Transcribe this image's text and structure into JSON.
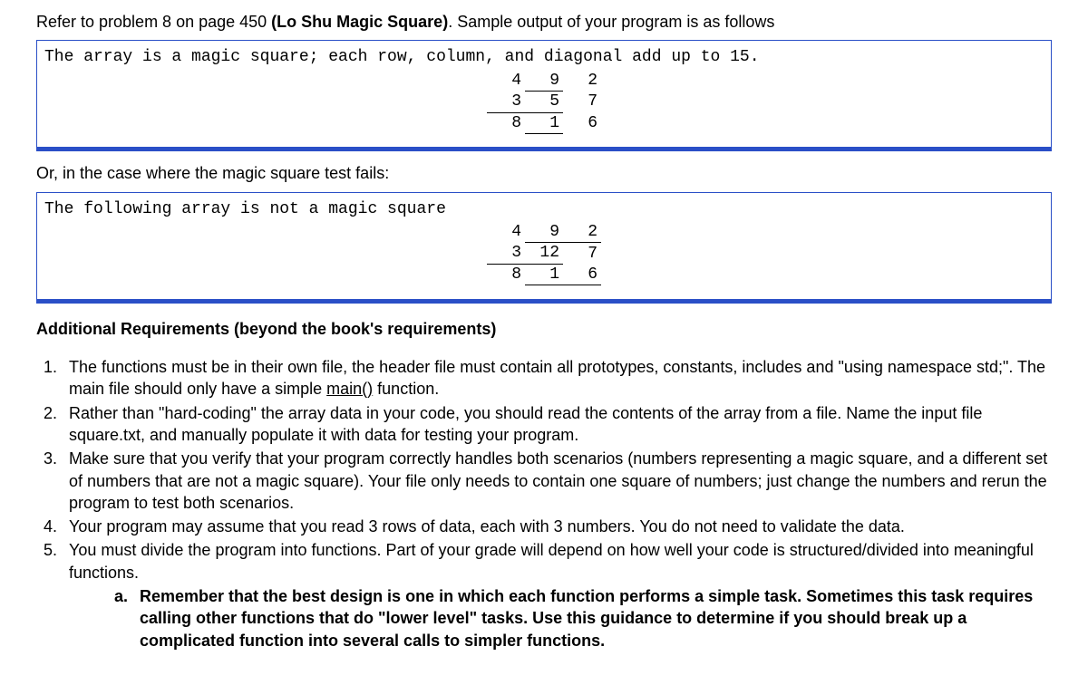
{
  "intro_prefix": "Refer to problem 8 on page 450 ",
  "intro_bold": "(Lo Shu Magic Square)",
  "intro_suffix": ". Sample output of your program is as follows",
  "sample1": {
    "message": "The array is a magic square; each row, column, and diagonal add up to 15.",
    "grid": {
      "r1c1": "4",
      "r1c2": "9",
      "r1c3": "2",
      "r2c1": "3",
      "r2c2": "5",
      "r2c3": "7",
      "r3c1": "8",
      "r3c2": "1",
      "r3c3": "6"
    }
  },
  "case2_text": "Or, in the case where the magic square test fails:",
  "sample2": {
    "message": "The following array is not a magic square",
    "grid": {
      "r1c1": "4",
      "r1c2": "9",
      "r1c3": "2",
      "r2c1": "3",
      "r2c2": "12",
      "r2c3": "7",
      "r3c1": "8",
      "r3c2": "1",
      "r3c3": "6"
    }
  },
  "ar_heading": "Additional Requirements (beyond the book's requirements)",
  "reqs": {
    "r1a": "The functions must be in their own file, the header file must contain all prototypes, constants, includes and \"using namespace std;\".  The main file should only have a simple ",
    "r1_main": "main()",
    "r1b": " function.",
    "r2": "Rather than \"hard-coding\" the array data in your code, you should read the contents of the array from a file. Name the input file square.txt, and manually populate it with data for testing your program.",
    "r3": "Make sure that you verify that your program correctly handles both scenarios (numbers representing a magic square, and a different set of numbers that are not a magic square). Your file only needs to contain one square of numbers; just change the numbers and rerun the program to test both scenarios.",
    "r4": "Your program may assume that you read 3 rows of data, each with 3 numbers. You do not need to validate the data.",
    "r5": "You must divide the program into functions. Part of your grade will depend on how well your code is structured/divided into meaningful functions.",
    "r5a": "Remember that the best design is one in which each function performs a simple task. Sometimes this task requires calling other functions that do \"lower level\" tasks.  Use this guidance to determine if you should break up a complicated function into several calls to simpler functions."
  }
}
